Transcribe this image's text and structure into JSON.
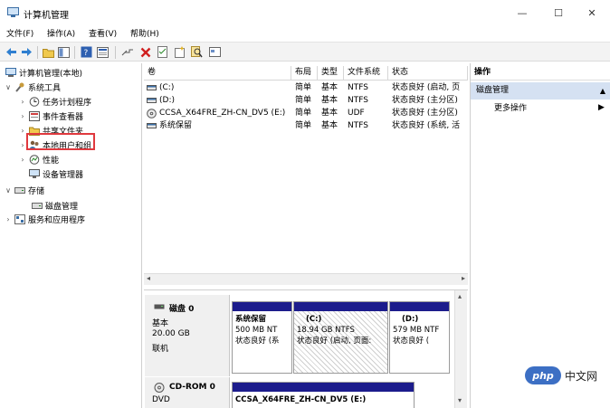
{
  "window": {
    "title": "计算机管理",
    "min": "—",
    "max": "☐",
    "close": "✕"
  },
  "menu": [
    "文件(F)",
    "操作(A)",
    "查看(V)",
    "帮助(H)"
  ],
  "tree": {
    "root": "计算机管理(本地)",
    "system_tools": "系统工具",
    "system_items": [
      "任务计划程序",
      "事件查看器",
      "共享文件夹",
      "本地用户和组",
      "性能",
      "设备管理器"
    ],
    "storage": "存储",
    "disk_mgmt": "磁盘管理",
    "services": "服务和应用程序"
  },
  "volumes": {
    "headers": [
      "卷",
      "布局",
      "类型",
      "文件系统",
      "状态"
    ],
    "rows": [
      {
        "name": "(C:)",
        "layout": "简单",
        "type": "基本",
        "fs": "NTFS",
        "status": "状态良好 (启动, 页"
      },
      {
        "name": "(D:)",
        "layout": "简单",
        "type": "基本",
        "fs": "NTFS",
        "status": "状态良好 (主分区)"
      },
      {
        "name": "CCSA_X64FRE_ZH-CN_DV5 (E:)",
        "layout": "简单",
        "type": "基本",
        "fs": "UDF",
        "status": "状态良好 (主分区)"
      },
      {
        "name": "系统保留",
        "layout": "简单",
        "type": "基本",
        "fs": "NTFS",
        "status": "状态良好 (系统, 活"
      }
    ]
  },
  "disks": [
    {
      "name": "磁盘 0",
      "type": "基本",
      "size": "20.00 GB",
      "state": "联机",
      "partitions": [
        {
          "label": "系统保留",
          "size": "500 MB NT",
          "status": "状态良好 (系"
        },
        {
          "label": "(C:)",
          "size": "18.94 GB NTFS",
          "status": "状态良好 (启动, 页面:"
        },
        {
          "label": "(D:)",
          "size": "579 MB NTF",
          "status": "状态良好 ("
        }
      ]
    },
    {
      "name": "CD-ROM 0",
      "type": "DVD",
      "partitions": [
        {
          "label": "CCSA_X64FRE_ZH-CN_DV5 (E:)"
        }
      ]
    }
  ],
  "actions": {
    "header": "操作",
    "selected": "磁盘管理",
    "more": "更多操作"
  },
  "watermark": {
    "logo": "php",
    "text": "中文网"
  },
  "colors": {
    "partition_bar": "#1c1c8c",
    "selected_action": "#d5e1f2",
    "highlight": "#e0393e"
  }
}
